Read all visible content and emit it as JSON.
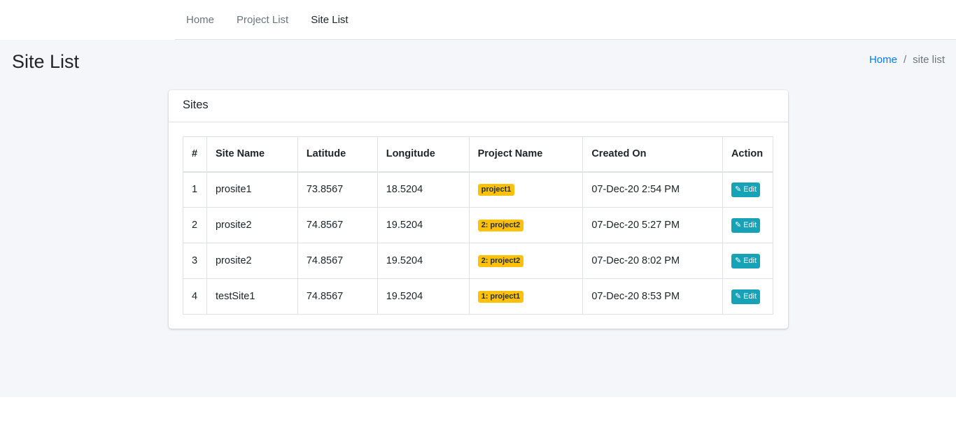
{
  "nav": {
    "items": [
      {
        "label": "Home",
        "active": false
      },
      {
        "label": "Project List",
        "active": false
      },
      {
        "label": "Site List",
        "active": true
      }
    ]
  },
  "page": {
    "title": "Site List",
    "breadcrumb": {
      "home": "Home",
      "separator": "/",
      "current": "site list"
    }
  },
  "card": {
    "title": "Sites",
    "columns": [
      "#",
      "Site Name",
      "Latitude",
      "Longitude",
      "Project Name",
      "Created On",
      "Action"
    ],
    "rows": [
      {
        "num": "1",
        "site": "prosite1",
        "lat": "73.8567",
        "lng": "18.5204",
        "project": "project1",
        "created": "07-Dec-20 2:54 PM",
        "action": "Edit"
      },
      {
        "num": "2",
        "site": "prosite2",
        "lat": "74.8567",
        "lng": "19.5204",
        "project": "2: project2",
        "created": "07-Dec-20 5:27 PM",
        "action": "Edit"
      },
      {
        "num": "3",
        "site": "prosite2",
        "lat": "74.8567",
        "lng": "19.5204",
        "project": "2: project2",
        "created": "07-Dec-20 8:02 PM",
        "action": "Edit"
      },
      {
        "num": "4",
        "site": "testSite1",
        "lat": "74.8567",
        "lng": "19.5204",
        "project": "1: project1",
        "created": "07-Dec-20 8:53 PM",
        "action": "Edit"
      }
    ]
  },
  "colors": {
    "accent": "#007bff",
    "badge": "#ffc107",
    "edit_button": "#17a2b8",
    "content_bg": "#f4f6f9"
  },
  "icons": {
    "edit": "pencil-icon"
  }
}
